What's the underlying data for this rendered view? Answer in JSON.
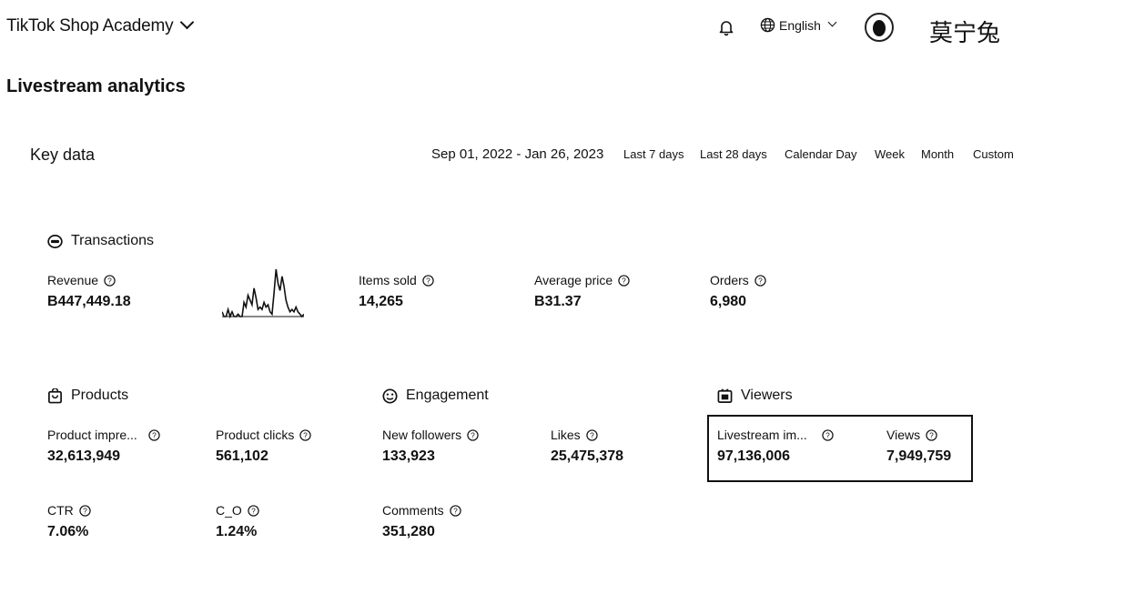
{
  "header": {
    "app_title": "TikTok Shop Academy",
    "language": "English",
    "username": "莫宁兔"
  },
  "page": {
    "title": "Livestream analytics"
  },
  "key_data": {
    "title": "Key data",
    "date_range": "Sep 01, 2022 - Jan 26, 2023",
    "ranges": [
      "Last 7 days",
      "Last 28 days",
      "Calendar Day",
      "Week",
      "Month",
      "Custom"
    ]
  },
  "transactions": {
    "title": "Transactions",
    "revenue": {
      "label": "Revenue",
      "currency": "B",
      "value": "447,449.18"
    },
    "items_sold": {
      "label": "Items sold",
      "value": "14,265"
    },
    "average_price": {
      "label": "Average price",
      "currency": "B",
      "value": "31.37"
    },
    "orders": {
      "label": "Orders",
      "value": "6,980"
    }
  },
  "products": {
    "title": "Products",
    "impressions": {
      "label": "Product impre...",
      "value": "32,613,949"
    },
    "clicks": {
      "label": "Product clicks",
      "value": "561,102"
    },
    "ctr": {
      "label": "CTR",
      "value": "7.06%"
    },
    "co": {
      "label": "C_O",
      "value": "1.24%"
    }
  },
  "engagement": {
    "title": "Engagement",
    "new_followers": {
      "label": "New followers",
      "value": "133,923"
    },
    "likes": {
      "label": "Likes",
      "value": "25,475,378"
    },
    "comments": {
      "label": "Comments",
      "value": "351,280"
    }
  },
  "viewers": {
    "title": "Viewers",
    "livestream_impressions": {
      "label": "Livestream im...",
      "value": "97,136,006"
    },
    "views": {
      "label": "Views",
      "value": "7,949,759"
    }
  },
  "revenue_sparkline": [
    0.1,
    0,
    0,
    0.15,
    0,
    0.1,
    0,
    0,
    0.05,
    0,
    0,
    0.3,
    0.2,
    0.45,
    0.35,
    0.25,
    0.6,
    0.4,
    0.15,
    0.2,
    0.15,
    0.3,
    0.2,
    0.25,
    0.1,
    0.05,
    0.5,
    1.0,
    0.7,
    0.55,
    0.85,
    0.65,
    0.35,
    0.2,
    0.1,
    0.15,
    0.1,
    0.2,
    0.1,
    0.05,
    0,
    0.05
  ]
}
